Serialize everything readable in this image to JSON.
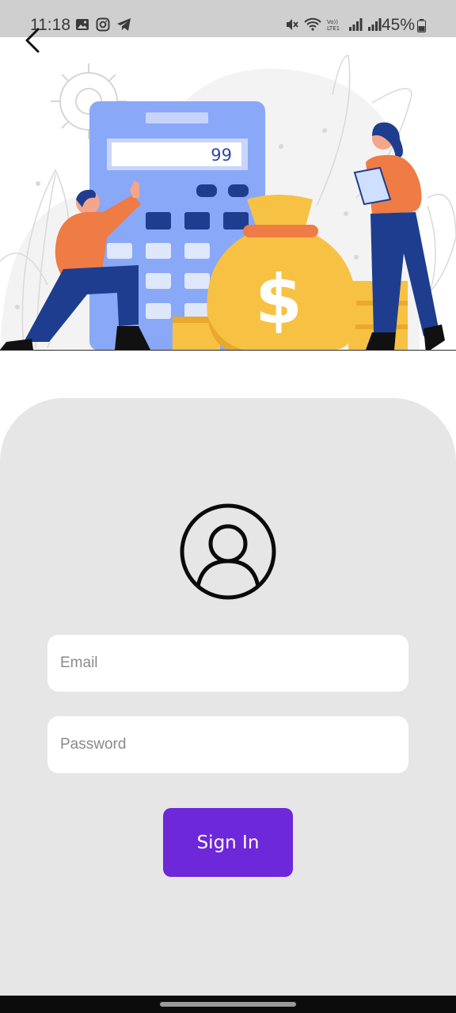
{
  "status_bar": {
    "time": "11:18",
    "battery_text": "45%",
    "icons_left": [
      "image-icon",
      "instagram-icon",
      "telegram-icon"
    ],
    "icons_right": [
      "mute-icon",
      "wifi-icon",
      "volte-icon",
      "signal-icon",
      "signal-r-icon"
    ]
  },
  "hero": {
    "calculator_display": "99",
    "colors": {
      "calculator": "#8aa8f8",
      "keys_dark": "#1e3d8f",
      "keys_light": "#dfe7fb",
      "money": "#f7c244",
      "money_dark": "#e8a92c",
      "shirt": "#ef7b45",
      "pants": "#1e3d8f",
      "leaves": "#f2f2f2"
    }
  },
  "login": {
    "email_placeholder": "Email",
    "password_placeholder": "Password",
    "signin_label": "Sign In"
  },
  "colors": {
    "card_bg": "#e6e6e6",
    "accent": "#6d28d9",
    "status_bar_bg": "#cfcfcf"
  }
}
